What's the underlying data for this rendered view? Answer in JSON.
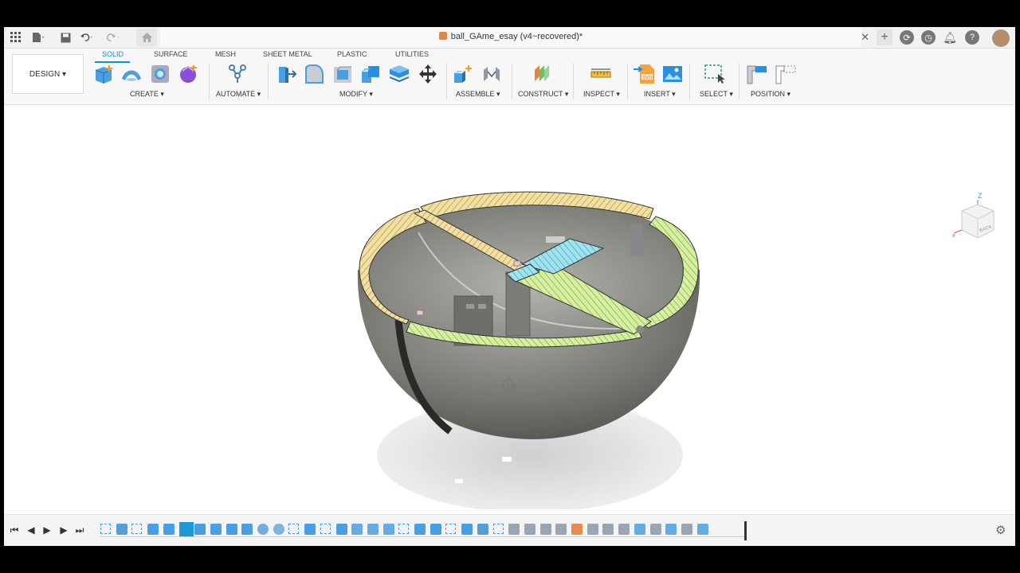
{
  "document": {
    "title": "ball_GAme_esay (v4~recovered)*"
  },
  "toolbar": {
    "workspace_button": "DESIGN ▾",
    "tabs": [
      "SOLID",
      "SURFACE",
      "MESH",
      "SHEET METAL",
      "PLASTIC",
      "UTILITIES"
    ],
    "active_tab": "SOLID",
    "groups": [
      "CREATE ▾",
      "AUTOMATE ▾",
      "MODIFY ▾",
      "ASSEMBLE ▾",
      "CONSTRUCT ▾",
      "INSPECT ▾",
      "INSERT ▾",
      "SELECT ▾",
      "POSITION ▾"
    ]
  },
  "viewcube": {
    "face_label": "BACK",
    "axis_label": "Z"
  },
  "colors": {
    "accent": "#0696d7",
    "hatch_yellow": "#f3dfa0",
    "hatch_green": "#d6f0a0",
    "hatch_cyan": "#9fe3ef",
    "body_gray": "#6c6c68"
  },
  "icons": {
    "titlebar": [
      "apps-grid-icon",
      "file-icon",
      "save-icon",
      "undo-icon",
      "redo-icon",
      "home-icon"
    ],
    "right": [
      "new-tab-icon",
      "extensions-icon",
      "job-status-icon",
      "notifications-icon",
      "help-icon",
      "user-avatar"
    ],
    "timeline_controls": [
      "go-to-start-icon",
      "step-back-icon",
      "play-icon",
      "step-forward-icon",
      "go-to-end-icon"
    ]
  }
}
